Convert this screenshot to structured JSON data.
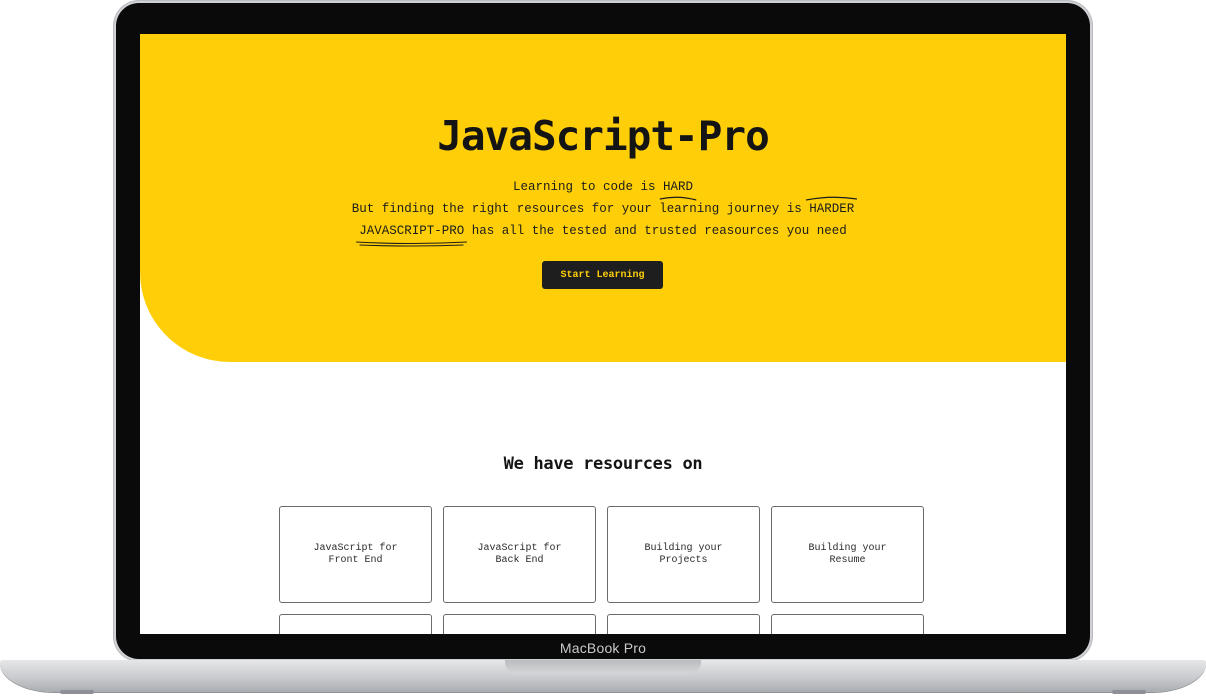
{
  "device": {
    "label": "MacBook Pro"
  },
  "hero": {
    "title": "JavaScript-Pro",
    "line1_a": "Learning to code is ",
    "line1_b": "HARD",
    "line2_a": "But finding the right resources for your learning journey is ",
    "line2_b": "HARDER",
    "line3_a": "JAVASCRIPT-PRO",
    "line3_b": " has all the tested and trusted reasources you need",
    "cta_label": "Start Learning"
  },
  "resources": {
    "title": "We have resources on",
    "cards": [
      {
        "label": "JavaScript for Front End"
      },
      {
        "label": "JavaScript for Back End"
      },
      {
        "label": "Building your Projects"
      },
      {
        "label": "Building your Resume"
      },
      {
        "label": ""
      },
      {
        "label": ""
      },
      {
        "label": ""
      },
      {
        "label": ""
      }
    ]
  },
  "colors": {
    "accent": "#fecf08",
    "dark": "#1e1e1e"
  }
}
